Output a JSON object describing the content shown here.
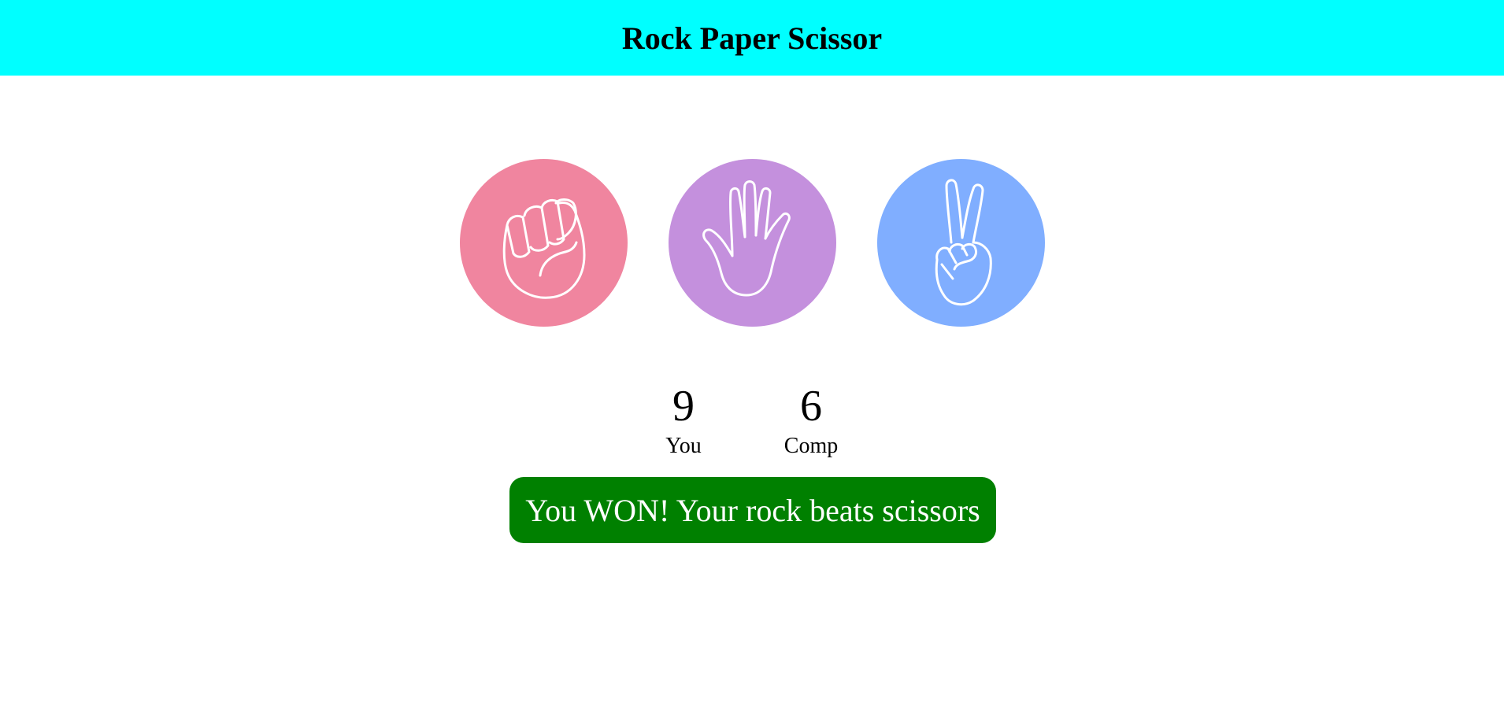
{
  "header": {
    "title": "Rock Paper Scissor"
  },
  "choices": [
    {
      "id": "rock",
      "icon": "fist-icon",
      "color": "#f0859f"
    },
    {
      "id": "paper",
      "icon": "open-hand-icon",
      "color": "#c490dd"
    },
    {
      "id": "scissors",
      "icon": "peace-hand-icon",
      "color": "#80aeff"
    }
  ],
  "scores": {
    "you": {
      "value": "9",
      "label": "You"
    },
    "comp": {
      "value": "6",
      "label": "Comp"
    }
  },
  "message": {
    "text": "You WON! Your rock beats scissors",
    "color": "#008000"
  },
  "colors": {
    "header_bg": "#00ffff"
  }
}
